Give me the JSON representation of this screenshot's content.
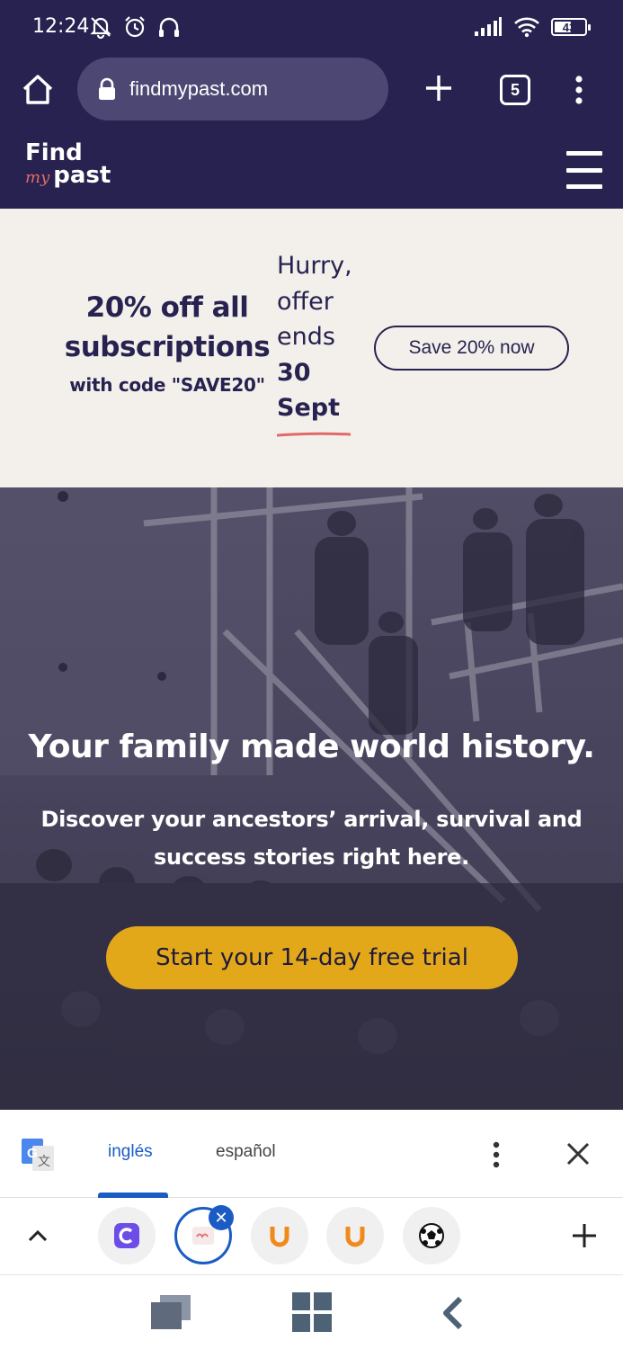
{
  "status_bar": {
    "time": "12:24",
    "battery": "43",
    "icons": [
      "muted-bell-icon",
      "alarm-icon",
      "headphones-icon",
      "signal-icon",
      "wifi-icon",
      "battery-icon"
    ]
  },
  "browser": {
    "url": "findmypast.com",
    "tab_count": "5",
    "icons": [
      "home-icon",
      "lock-icon",
      "plus-icon",
      "tabs-icon",
      "more-vert-icon"
    ]
  },
  "site_header": {
    "logo_find": "Find",
    "logo_my": "my",
    "logo_past": "past",
    "menu_icon": "hamburger-icon"
  },
  "promo": {
    "title_line1": "20% off all",
    "title_line2": "subscriptions",
    "code_text": "with code \"SAVE20\"",
    "hurry_1": "Hurry,",
    "hurry_2": "offer",
    "hurry_3": "ends",
    "date_1": "30",
    "date_2": "Sept",
    "button_label": "Save 20% now",
    "underline_color": "#e06a6a"
  },
  "hero": {
    "heading": "Your family made world history.",
    "subheading": "Discover your ancestors’ arrival, survival and success stories right here.",
    "cta_label": "Start your 14-day free trial",
    "cta_color": "#e2a81a"
  },
  "translate_bar": {
    "source_language": "inglés",
    "target_language": "español",
    "active_color": "#1a5cc4"
  },
  "tab_strip": {
    "tabs": [
      {
        "icon": "c-app-icon"
      },
      {
        "icon": "findmypast-favicon",
        "active": true
      },
      {
        "icon": "u-icon"
      },
      {
        "icon": "u-icon"
      },
      {
        "icon": "soccer-ball-icon"
      }
    ]
  },
  "nav_bar": {
    "icons": [
      "recents-icon",
      "home-grid-icon",
      "back-icon"
    ]
  },
  "colors": {
    "brand_navy": "#27224f",
    "promo_bg": "#f3f0ec"
  }
}
